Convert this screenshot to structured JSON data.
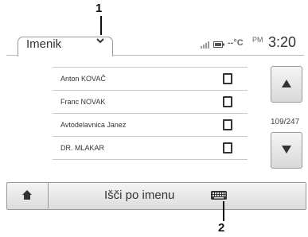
{
  "callouts": {
    "one": "1",
    "two": "2"
  },
  "header": {
    "title": "Imenik",
    "temperature": "--°C",
    "am_pm": "PM",
    "time": "3:20"
  },
  "contacts": [
    {
      "name": "Anton KOVAČ"
    },
    {
      "name": "Franc NOVAK"
    },
    {
      "name": "Avtodelavnica Janez"
    },
    {
      "name": "DR. MLAKAR"
    }
  ],
  "pager": {
    "counter": "109/247"
  },
  "bottom": {
    "search_label": "Išči po imenu"
  },
  "icons": {
    "home": "home-icon",
    "keyboard": "keyboard-icon",
    "up": "arrow-up-icon",
    "down": "arrow-down-icon",
    "phone": "phone-icon",
    "signal": "signal-icon",
    "battery": "battery-icon",
    "chevron": "chevron-down-icon"
  }
}
